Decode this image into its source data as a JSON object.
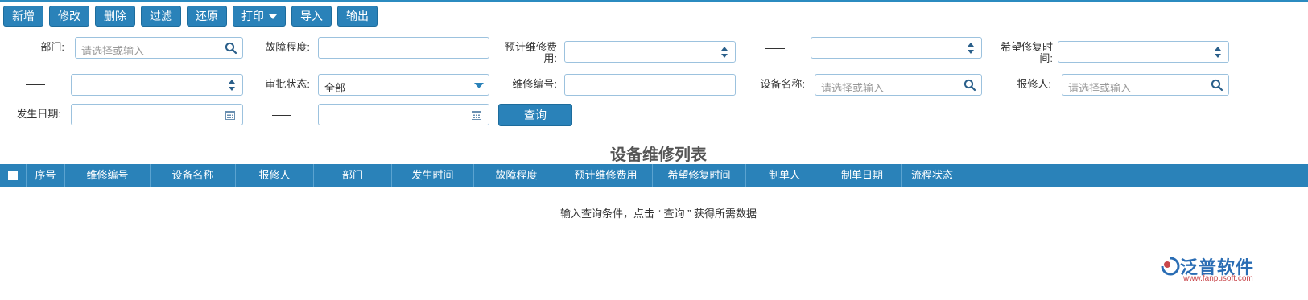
{
  "toolbar": {
    "buttons": [
      "新增",
      "修改",
      "删除",
      "过滤",
      "还原",
      "打印",
      "导入",
      "输出"
    ]
  },
  "filters": {
    "dept_label": "部门:",
    "dept_placeholder": "请选择或输入",
    "severity_label": "故障程度:",
    "est_cost_label_1": "预计维修费",
    "est_cost_label_2": "用:",
    "hope_time_label_1": "希望修复时",
    "hope_time_label_2": "间:",
    "approval_label": "审批状态:",
    "approval_value": "全部",
    "repair_no_label": "维修编号:",
    "device_name_label": "设备名称:",
    "device_name_placeholder": "请选择或输入",
    "reporter_label": "报修人:",
    "reporter_placeholder": "请选择或输入",
    "date_label": "发生日期:",
    "query_label": "查询"
  },
  "table": {
    "title": "设备维修列表",
    "columns": [
      "序号",
      "维修编号",
      "设备名称",
      "报修人",
      "部门",
      "发生时间",
      "故障程度",
      "预计维修费用",
      "希望修复时间",
      "制单人",
      "制单日期",
      "流程状态"
    ],
    "empty_text": "输入查询条件，点击 “ 查询 ” 获得所需数据"
  },
  "logo": {
    "text": "泛普软件",
    "url": "www.fanpusoft.com"
  },
  "colors": {
    "accent": "#2a82b9",
    "input_border": "#9cc2de"
  }
}
